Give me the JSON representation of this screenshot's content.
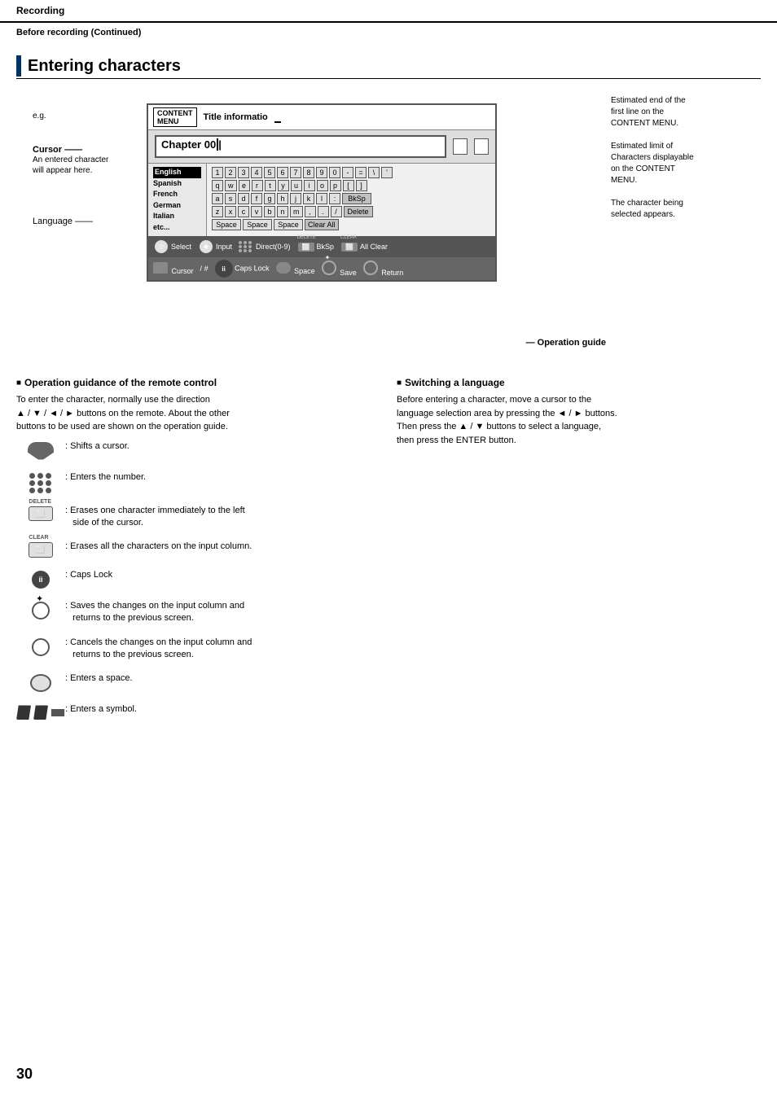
{
  "header": {
    "title": "Recording",
    "subheader": "Before recording (Continued)"
  },
  "section": {
    "title": "Entering characters"
  },
  "diagram": {
    "eg_label": "e.g.",
    "cursor_label": "Cursor",
    "cursor_desc": "An entered character\nwill appear here.",
    "language_label": "Language",
    "content_menu": "CONTENT\nMENU",
    "title_info": "Title informatio",
    "chapter_text": "Chapter 00",
    "languages": [
      "English",
      "Spanish",
      "French",
      "German",
      "Italian",
      "etc..."
    ],
    "selected_language": "English",
    "key_rows": [
      [
        "1",
        "2",
        "3",
        "4",
        "5",
        "6",
        "7",
        "8",
        "9",
        "0",
        "-",
        "=",
        "\\",
        "'"
      ],
      [
        "q",
        "w",
        "e",
        "r",
        "t",
        "y",
        "u",
        "i",
        "o",
        "p",
        "[",
        "]"
      ],
      [
        "a",
        "s",
        "d",
        "f",
        "g",
        "h",
        "j",
        "k",
        "l",
        ":",
        "BkSp"
      ],
      [
        "z",
        "x",
        "c",
        "v",
        "b",
        "n",
        "m",
        ",",
        ".",
        "/",
        "Delete"
      ],
      [
        "Space",
        "Space",
        "Space",
        "Clear All"
      ]
    ],
    "op_guide_row1": [
      {
        "icon": "select",
        "label": "Select"
      },
      {
        "icon": "input",
        "label": "Input"
      },
      {
        "icon": "numpad",
        "label": "Direct(0-9)"
      },
      {
        "icon": "delete",
        "label": "BkSp"
      },
      {
        "icon": "clear",
        "label": "All Clear"
      }
    ],
    "op_guide_row2": [
      {
        "icon": "cursor",
        "label": "Cursor"
      },
      {
        "symbol": "#"
      },
      {
        "icon": "caps",
        "label": "Caps Lock"
      },
      {
        "icon": "space",
        "label": "Space"
      },
      {
        "icon": "save",
        "label": "Save"
      },
      {
        "icon": "return",
        "label": "Return"
      }
    ],
    "operation_guide_label": "Operation guide",
    "right_annotations": [
      "Estimated end of the\nfirst line on the\nCONTENT MENU.",
      "Estimated limit of\nCharacters displayable\non the CONTENT\nMENU.",
      "The character being\nselected appears."
    ]
  },
  "op_guidance": {
    "heading": "Operation guidance of the remote control",
    "text1": "To enter the character, normally use the direction\n▲ / ▼ / ◄ / ► buttons on the remote. About the other\nbuttons to be used are shown on the operation guide.",
    "items": [
      {
        "desc": ": Shifts a cursor."
      },
      {
        "desc": ": Enters the number."
      },
      {
        "desc": ": Erases one character immediately to the left\nside of the cursor."
      },
      {
        "desc": ": Erases all the characters on the input column."
      },
      {
        "desc": ": Caps Lock"
      },
      {
        "desc": ": Saves the changes on the input column and\nreturns to the previous screen."
      },
      {
        "desc": ": Cancels the changes on the input column and\nreturns to the previous screen."
      },
      {
        "desc": ": Enters a space."
      },
      {
        "desc": ": Enters a symbol."
      }
    ]
  },
  "switching": {
    "heading": "Switching a language",
    "text": "Before entering a character, move a cursor to the\nlanguage selection area by pressing the ◄ / ► buttons.\nThen press the ▲ / ▼ buttons to select a language,\nthen press the ENTER button."
  },
  "page_number": "30"
}
